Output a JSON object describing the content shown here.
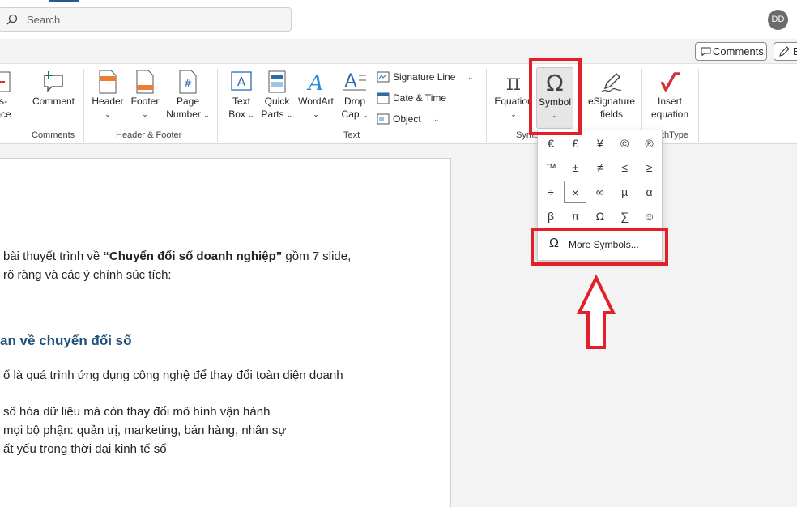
{
  "title_bar": {
    "search_placeholder": "Search",
    "avatar_initials": "DD"
  },
  "top_actions": {
    "comments_label": "Comments",
    "editing_label": "E"
  },
  "ribbon": {
    "partial_left": {
      "line1": "s-",
      "line2": "nce"
    },
    "comments_group": {
      "button": "Comment",
      "label": "Comments"
    },
    "header_footer_group": {
      "header": "Header",
      "footer": "Footer",
      "page_number_line1": "Page",
      "page_number_line2": "Number",
      "label": "Header & Footer"
    },
    "text_group": {
      "text_box_line1": "Text",
      "text_box_line2": "Box",
      "quick_parts_line1": "Quick",
      "quick_parts_line2": "Parts",
      "wordart": "WordArt",
      "drop_cap_line1": "Drop",
      "drop_cap_line2": "Cap",
      "signature_line": "Signature Line",
      "date_time": "Date & Time",
      "object": "Object",
      "label": "Text"
    },
    "symbols_group": {
      "equation": "Equation",
      "symbol": "Symbol",
      "label_partial": "Symb"
    },
    "esignature": {
      "line1": "eSignature",
      "line2": "fields"
    },
    "mathtype": {
      "line1": "Insert",
      "line2": "equation",
      "label_partial": "thType"
    }
  },
  "symbol_dropdown": {
    "symbols": [
      "€",
      "£",
      "¥",
      "©",
      "®",
      "™",
      "±",
      "≠",
      "≤",
      "≥",
      "÷",
      "×",
      "∞",
      "µ",
      "α",
      "β",
      "π",
      "Ω",
      "∑",
      "☺"
    ],
    "selected_index": 11,
    "more_symbols": "More Symbols..."
  },
  "document": {
    "line1_pre": "bài thuyết trình về ",
    "line1_bold": "“Chuyển đổi số doanh nghiệp”",
    "line1_post": " gồm 7 slide,",
    "line2": "rõ ràng và các ý chính súc tích:",
    "heading": "an về chuyển đổi số",
    "line3": "ố là quá trình ứng dụng công nghệ để thay đổi toàn diện doanh",
    "line4": "số hóa dữ liệu mà còn thay đổi mô hình vận hành",
    "line5": "mọi bộ phận: quản trị, marketing, bán hàng, nhân sự",
    "line6": "ất yếu trong thời đại kinh tế số"
  },
  "colors": {
    "highlight": "#e3202a",
    "heading": "#1f4e79",
    "avatar": "#6b6b6b"
  }
}
